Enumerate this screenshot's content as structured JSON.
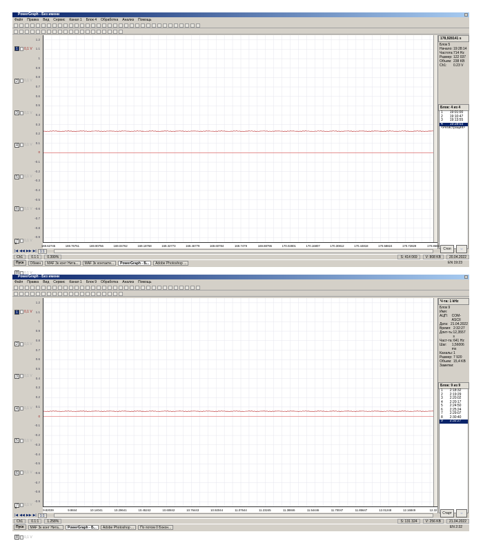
{
  "menu": [
    "Файл",
    "Правка",
    "Вид",
    "Сервис",
    "Канал 1",
    "Блок 4",
    "Обработка",
    "Анализ",
    "Помощь"
  ],
  "panels": [
    {
      "title": "PowerGraph - Без имени",
      "menu_block": "Блок 4",
      "side_header": "178,928141 s",
      "info": [
        [
          "Блок 5",
          ""
        ],
        [
          "Начало:",
          "19:28:14"
        ],
        [
          "Частота:",
          "714 Hz"
        ],
        [
          "Размер:",
          "122 037"
        ],
        [
          "Объем:",
          "238 KB"
        ],
        [
          "",
          ""
        ],
        [
          "Ch1:",
          "0.23 V"
        ]
      ],
      "blocks_header": "Блок: 4 из 4",
      "blocks": [
        [
          "1",
          "19:01:00"
        ],
        [
          "2",
          "19:10:47"
        ],
        [
          "3",
          "19:13:55"
        ],
        [
          "4",
          "19:28:03"
        ]
      ],
      "blocks_selected": 3,
      "blocks_extra": "<Регистрация>",
      "channels": [
        {
          "n": "1",
          "unit": "0,1 V"
        },
        {
          "n": "2",
          "unit": "0,1 V"
        },
        {
          "n": "3",
          "unit": "0,1 V"
        },
        {
          "n": "4",
          "unit": "0,1 V"
        },
        {
          "n": "5",
          "unit": "0,1 V"
        },
        {
          "n": "6",
          "unit": "0,1 V"
        },
        {
          "n": "7",
          "unit": "0,1 V"
        },
        {
          "n": "8",
          "unit": "0,1 V"
        }
      ],
      "xticks": [
        "169.62745",
        "169.76751",
        "169.90756",
        "169.04762",
        "169.18768",
        "169.32773",
        "169.46779",
        "169.60784",
        "169.7479",
        "169.88796",
        "170.02801",
        "170.16807",
        "170.30812",
        "170.44818",
        "170.58824",
        "170.72829",
        "170.8683"
      ],
      "nav_zoom": "1:1",
      "action_button": "Стоп",
      "status": [
        "Ch1",
        "0.1:1",
        "0.399%",
        "S: 414 069",
        "V: 808 KB",
        "20.04.2022"
      ],
      "tasks": [
        "Обмен",
        "MAF 3к конт Нита...",
        "MAF 3к контакти...",
        "PowerGraph - Б...",
        "Adobe Photoshop ..."
      ],
      "active_task": 3,
      "clock": "19:23",
      "lang": "EN",
      "start": "Пуск",
      "chart_data": {
        "type": "line",
        "ylim": [
          -0.95,
          1.25
        ],
        "yticks": [
          1.2,
          1.1,
          1.0,
          0.9,
          0.8,
          0.7,
          0.6,
          0.5,
          0.4,
          0.3,
          0.2,
          0.1,
          0,
          -0.1,
          -0.2,
          -0.3,
          -0.4,
          -0.5,
          -0.6,
          -0.7,
          -0.8,
          -0.9
        ],
        "ylabel": "V",
        "series": [
          {
            "name": "Ch1",
            "level": 0.23,
            "color": "#c04040"
          }
        ],
        "zero_line_color": "#e08080"
      }
    },
    {
      "title": "PowerGraph - Без имени",
      "menu_block": "Блок 9",
      "side_header": "Ч-та: 1 kHz",
      "info": [
        [
          "Блок 9",
          ""
        ],
        [
          "Имя:",
          ""
        ],
        [
          "АЦП:",
          "COM-ASCII"
        ],
        [
          "Дата:",
          "21.04.2022"
        ],
        [
          "Время:",
          "2:32:27"
        ],
        [
          "Длит-ть:",
          "12,3557 s"
        ],
        [
          "Част-та:",
          "641 Hz"
        ],
        [
          "Шаг:",
          "1,56006 ms"
        ],
        [
          "Каналы:",
          "1"
        ],
        [
          "Размер:",
          "7 920"
        ],
        [
          "Объем:",
          "15,4 KB"
        ],
        [
          "",
          ""
        ],
        [
          "Заметки:",
          ""
        ]
      ],
      "blocks_header": "Блок: 9 из 9",
      "blocks": [
        [
          "1",
          "2:18:32"
        ],
        [
          "2",
          "2:19:29"
        ],
        [
          "3",
          "2:20:02"
        ],
        [
          "4",
          "2:20:17"
        ],
        [
          "5",
          "2:24:50"
        ],
        [
          "6",
          "2:25:24"
        ],
        [
          "7",
          "2:29:07"
        ],
        [
          "8",
          "2:30:40"
        ],
        [
          "9",
          "2:32:27"
        ]
      ],
      "blocks_selected": 8,
      "blocks_extra": "",
      "channels": [
        {
          "n": "1",
          "unit": "0,1 V"
        },
        {
          "n": "2",
          "unit": "0,1 V"
        },
        {
          "n": "3",
          "unit": "0,1 V"
        },
        {
          "n": "4",
          "unit": "0,1 V"
        },
        {
          "n": "5",
          "unit": "0,1 V"
        },
        {
          "n": "6",
          "unit": "0,1 V"
        },
        {
          "n": "7",
          "unit": "0,1 V"
        },
        {
          "n": "8",
          "unit": "0,1 V"
        }
      ],
      "xticks": [
        "9.82039",
        "9.9844",
        "10.14041",
        "10.29641",
        "10.45242",
        "10.60842",
        "10.76443",
        "10.92044",
        "11.07644",
        "11.23245",
        "11.38846",
        "11.54446",
        "11.70047",
        "11.85647",
        "12.01248",
        "12.16849",
        "12.32"
      ],
      "nav_zoom": "1:1",
      "action_button": "Старт",
      "status": [
        "Ch1",
        "0.1:1",
        "1.258%",
        "S: 131 324",
        "V: 256 KB",
        "21.04.2022"
      ],
      "tasks": [
        "MAF 3к конт Нита...",
        "PowerGraph - Б...",
        "Adobe Photoshop ...",
        "По потом 0 Бокон..."
      ],
      "active_task": 1,
      "clock": "2:32",
      "lang": "EN",
      "start": "Пуск",
      "chart_data": {
        "type": "line",
        "ylim": [
          -0.95,
          1.25
        ],
        "yticks": [
          1.2,
          1.1,
          1.0,
          0.9,
          0.8,
          0.7,
          0.6,
          0.5,
          0.4,
          0.3,
          0.2,
          0.1,
          0,
          -0.1,
          -0.2,
          -0.3,
          -0.4,
          -0.5,
          -0.6,
          -0.7,
          -0.8,
          -0.9
        ],
        "ylabel": "V",
        "series": [
          {
            "name": "Ch1",
            "level": 0.055,
            "color": "#c04040"
          }
        ],
        "zero_line_color": "#e08080"
      }
    }
  ],
  "chart_data": [
    {
      "type": "line",
      "title": "Ch1 (top screenshot)",
      "ylim": [
        -0.95,
        1.25
      ],
      "x_range": [
        169.62745,
        170.8683
      ],
      "series": [
        {
          "name": "Ch1",
          "level": 0.23
        }
      ]
    },
    {
      "type": "line",
      "title": "Ch1 (bottom screenshot)",
      "ylim": [
        -0.95,
        1.25
      ],
      "x_range": [
        9.82039,
        12.32
      ],
      "series": [
        {
          "name": "Ch1",
          "level": 0.055
        }
      ]
    }
  ]
}
